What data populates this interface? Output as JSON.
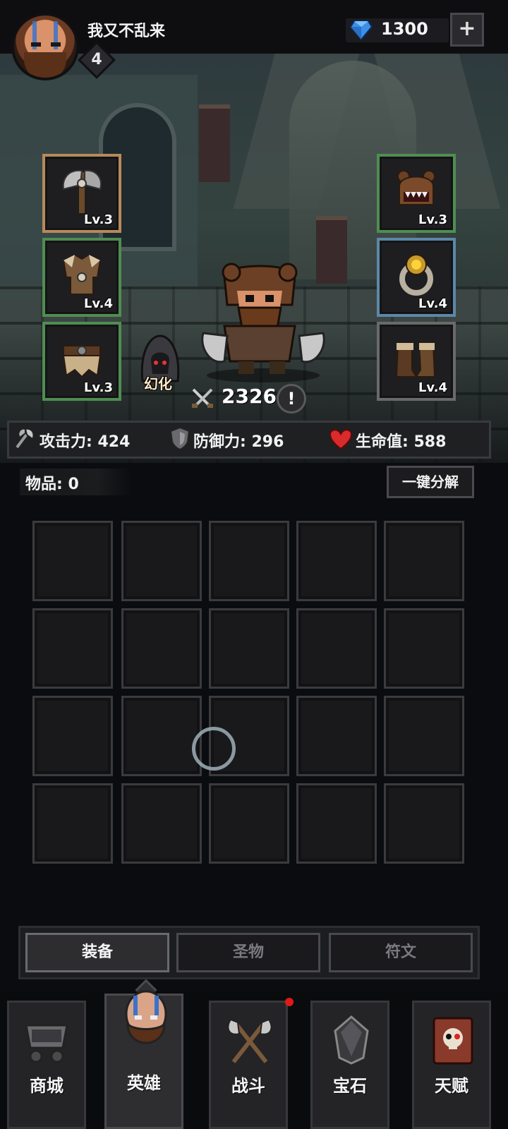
{
  "player": {
    "name": "我又不乱来",
    "level": "4",
    "avatar_icon": "bearded-warrior-avatar-icon"
  },
  "currency": {
    "gems": "1300",
    "gem_icon": "blue-diamond-icon",
    "add_label": "+"
  },
  "equipment": {
    "left": [
      {
        "icon": "battle-axe-icon",
        "level": "Lv.3",
        "rarity_color": "#b58a5a"
      },
      {
        "icon": "fur-armor-icon",
        "level": "Lv.4",
        "rarity_color": "#4f8d52"
      },
      {
        "icon": "fur-belt-icon",
        "level": "Lv.3",
        "rarity_color": "#4f8d52"
      }
    ],
    "right": [
      {
        "icon": "bear-helmet-icon",
        "level": "Lv.3",
        "rarity_color": "#4f8d52"
      },
      {
        "icon": "gold-ring-icon",
        "level": "Lv.4",
        "rarity_color": "#5d87a8"
      },
      {
        "icon": "fur-boots-icon",
        "level": "Lv.4",
        "rarity_color": "#6a6a6a"
      }
    ]
  },
  "hero": {
    "skin_label": "幻化",
    "power": "2326",
    "info_label": "!"
  },
  "stats": {
    "attack": "攻击力: 424",
    "defense": "防御力: 296",
    "health": "生命值: 588"
  },
  "inventory": {
    "label": "物品: 0",
    "decompose_label": "一键分解"
  },
  "sub_tabs": [
    "装备",
    "圣物",
    "符文"
  ],
  "nav": [
    {
      "label": "商城",
      "icon": "cart-icon"
    },
    {
      "label": "英雄",
      "icon": "hero-face-icon"
    },
    {
      "label": "战斗",
      "icon": "crossed-axes-icon"
    },
    {
      "label": "宝石",
      "icon": "crystal-icon"
    },
    {
      "label": "天赋",
      "icon": "skull-book-icon"
    }
  ],
  "colors": {
    "accent_red": "#e11919",
    "gem_blue": "#3a8fe6",
    "heart_red": "#d92b2b"
  }
}
